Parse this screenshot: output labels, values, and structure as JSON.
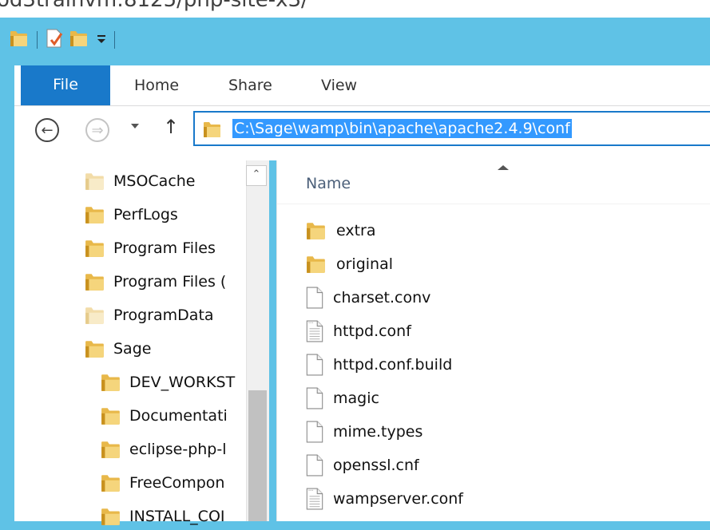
{
  "background_title": "od3trainvm:8125/php-site-x3/",
  "quick_access": {
    "icons": [
      "folder-icon",
      "properties-icon",
      "new-folder-icon",
      "customize-dropdown-icon"
    ]
  },
  "ribbon": {
    "tabs": [
      {
        "id": "file",
        "label": "File"
      },
      {
        "id": "home",
        "label": "Home"
      },
      {
        "id": "share",
        "label": "Share"
      },
      {
        "id": "view",
        "label": "View"
      }
    ]
  },
  "address_bar": {
    "path": "C:\\Sage\\wamp\\bin\\apache\\apache2.4.9\\conf"
  },
  "navigation_pane": {
    "items": [
      {
        "label": "MSOCache",
        "icon": "folder-icon-faded",
        "indent": 0
      },
      {
        "label": "PerfLogs",
        "icon": "folder-icon",
        "indent": 0
      },
      {
        "label": "Program Files",
        "icon": "folder-icon",
        "indent": 0
      },
      {
        "label": "Program Files (",
        "icon": "folder-icon",
        "indent": 0
      },
      {
        "label": "ProgramData",
        "icon": "folder-icon-faded",
        "indent": 0
      },
      {
        "label": "Sage",
        "icon": "folder-icon",
        "indent": 0
      },
      {
        "label": "DEV_WORKST",
        "icon": "folder-icon",
        "indent": 1
      },
      {
        "label": "Documentati",
        "icon": "folder-icon",
        "indent": 1
      },
      {
        "label": "eclipse-php-l",
        "icon": "folder-icon",
        "indent": 1
      },
      {
        "label": "FreeCompon",
        "icon": "folder-icon",
        "indent": 1
      },
      {
        "label": "INSTALL_COI",
        "icon": "folder-icon",
        "indent": 1
      }
    ]
  },
  "file_list": {
    "column_name": "Name",
    "items": [
      {
        "name": "extra",
        "type": "folder"
      },
      {
        "name": "original",
        "type": "folder"
      },
      {
        "name": "charset.conv",
        "type": "file"
      },
      {
        "name": "httpd.conf",
        "type": "text-file"
      },
      {
        "name": "httpd.conf.build",
        "type": "file"
      },
      {
        "name": "magic",
        "type": "file"
      },
      {
        "name": "mime.types",
        "type": "file"
      },
      {
        "name": "openssl.cnf",
        "type": "file"
      },
      {
        "name": "wampserver.conf",
        "type": "text-file"
      }
    ]
  },
  "colors": {
    "title_bar": "#5fc2e6",
    "file_tab": "#1979ca",
    "selection": "#3399ff",
    "folder": "#e8b84a"
  }
}
